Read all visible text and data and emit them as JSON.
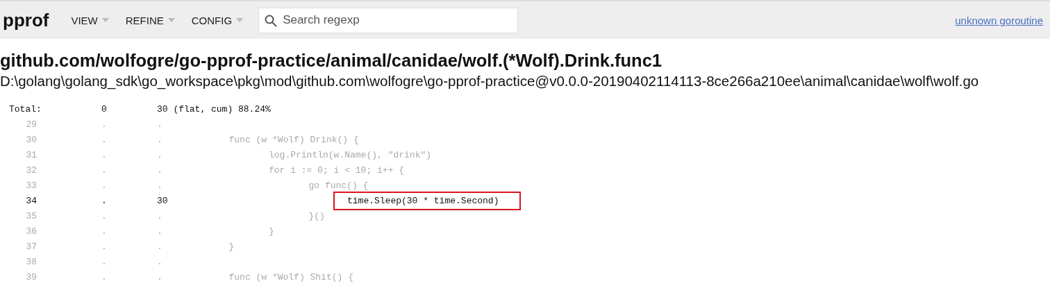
{
  "header": {
    "logo": "pprof",
    "menus": [
      {
        "label": "VIEW"
      },
      {
        "label": "REFINE"
      },
      {
        "label": "CONFIG"
      }
    ],
    "search": {
      "placeholder": "Search regexp"
    },
    "link": "unknown goroutine"
  },
  "function": {
    "title": "github.com/wolfogre/go-pprof-practice/animal/canidae/wolf.(*Wolf).Drink.func1",
    "path": "D:\\golang\\golang_sdk\\go_workspace\\pkg\\mod\\github.com\\wolfogre\\go-pprof-practice@v0.0.0-20190402114113-8ce266a210ee\\animal\\canidae\\wolf\\wolf.go"
  },
  "total": {
    "label": "Total:",
    "flat": "0",
    "cum": "30 (flat, cum) 88.24%"
  },
  "lines": [
    {
      "number": "29",
      "flat": ".",
      "cum": ".",
      "hot": false
    },
    {
      "number": "30",
      "flat": ".",
      "cum": ".",
      "code": "\tfunc (w *Wolf) Drink() {",
      "hot": false,
      "highlighted": false
    },
    {
      "number": "31",
      "flat": ".",
      "cum": ".",
      "code": "\t\tlog.Println(w.Name(), \"drink\")",
      "hot": false,
      "highlighted": false
    },
    {
      "number": "32",
      "flat": ".",
      "cum": ".",
      "code": "\t\tfor i := 0; i < 10; i++ {",
      "hot": false,
      "highlighted": false
    },
    {
      "number": "33",
      "flat": ".",
      "cum": ".",
      "code": "\t\t\tgo func() {",
      "hot": false,
      "highlighted": false
    },
    {
      "number": "34",
      "flat": ".",
      "cum": "30",
      "code": "\t\t\t\ttime.Sleep(30 * time.Second)",
      "hot": true,
      "highlighted": true
    },
    {
      "number": "35",
      "flat": ".",
      "cum": ".",
      "code": "\t\t\t}()",
      "hot": false,
      "highlighted": false
    },
    {
      "number": "36",
      "flat": ".",
      "cum": ".",
      "code": "\t\t}",
      "hot": false,
      "highlighted": false
    },
    {
      "number": "37",
      "flat": ".",
      "cum": ".",
      "code": "\t}",
      "hot": false,
      "highlighted": false
    },
    {
      "number": "38",
      "flat": ".",
      "cum": ".",
      "hot": false
    },
    {
      "number": "39",
      "flat": ".",
      "cum": ".",
      "code": "\tfunc (w *Wolf) Shit() {",
      "hot": false,
      "highlighted": false
    }
  ]
}
